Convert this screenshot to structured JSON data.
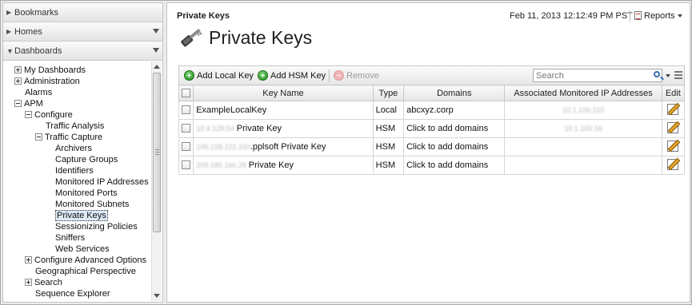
{
  "nav": {
    "bookmarks": "Bookmarks",
    "homes": "Homes",
    "dashboards": "Dashboards"
  },
  "tree": [
    {
      "label": "My Dashboards",
      "toggle": "plus",
      "level": 0
    },
    {
      "label": "Administration",
      "toggle": "plus",
      "level": 0
    },
    {
      "label": "Alarms",
      "toggle": "none",
      "level": 0
    },
    {
      "label": "APM",
      "toggle": "minus",
      "level": 0
    },
    {
      "label": "Configure",
      "toggle": "minus",
      "level": 1
    },
    {
      "label": "Traffic Analysis",
      "toggle": "none",
      "level": 2
    },
    {
      "label": "Traffic Capture",
      "toggle": "minus",
      "level": 2
    },
    {
      "label": "Archivers",
      "toggle": "none",
      "level": 3
    },
    {
      "label": "Capture Groups",
      "toggle": "none",
      "level": 3
    },
    {
      "label": "Identifiers",
      "toggle": "none",
      "level": 3
    },
    {
      "label": "Monitored IP Addresses",
      "toggle": "none",
      "level": 3
    },
    {
      "label": "Monitored Ports",
      "toggle": "none",
      "level": 3
    },
    {
      "label": "Monitored Subnets",
      "toggle": "none",
      "level": 3
    },
    {
      "label": "Private Keys",
      "toggle": "none",
      "level": 3,
      "selected": true
    },
    {
      "label": "Sessionizing Policies",
      "toggle": "none",
      "level": 3
    },
    {
      "label": "Sniffers",
      "toggle": "none",
      "level": 3
    },
    {
      "label": "Web Services",
      "toggle": "none",
      "level": 3
    },
    {
      "label": "Configure Advanced Options",
      "toggle": "plus",
      "level": 1
    },
    {
      "label": "Geographical Perspective",
      "toggle": "none",
      "level": 1
    },
    {
      "label": "Search",
      "toggle": "plus",
      "level": 1
    },
    {
      "label": "Sequence Explorer",
      "toggle": "none",
      "level": 1
    }
  ],
  "header": {
    "breadcrumb": "Private Keys",
    "timestamp": "Feb 11, 2013 12:12:49 PM PST",
    "reports": "Reports",
    "title": "Private Keys"
  },
  "toolbar": {
    "add_local": "Add Local Key",
    "add_hsm": "Add HSM Key",
    "remove": "Remove",
    "search_placeholder": "Search"
  },
  "table": {
    "columns": [
      "",
      "Key Name",
      "Type",
      "Domains",
      "Associated Monitored IP Addresses",
      "Edit"
    ],
    "rows": [
      {
        "name_blur": "",
        "name": "ExampleLocalKey",
        "type": "Local",
        "domains": "abcxyz.corp",
        "ips": "10.1.100.110"
      },
      {
        "name_blur": "10.4.128.54",
        "name": " Private Key",
        "type": "HSM",
        "domains": "Click to add domains",
        "ips": "10.1.100.16"
      },
      {
        "name_blur": "199.228.222.150",
        "name": ".pplsoft Private Key",
        "type": "HSM",
        "domains": "Click to add domains",
        "ips": ""
      },
      {
        "name_blur": "209.185.166.29",
        "name": " Private Key",
        "type": "HSM",
        "domains": "Click to add domains",
        "ips": ""
      }
    ]
  },
  "colors": {
    "accent_green": "#1e8a1b",
    "search_blue": "#3a6fb0"
  }
}
